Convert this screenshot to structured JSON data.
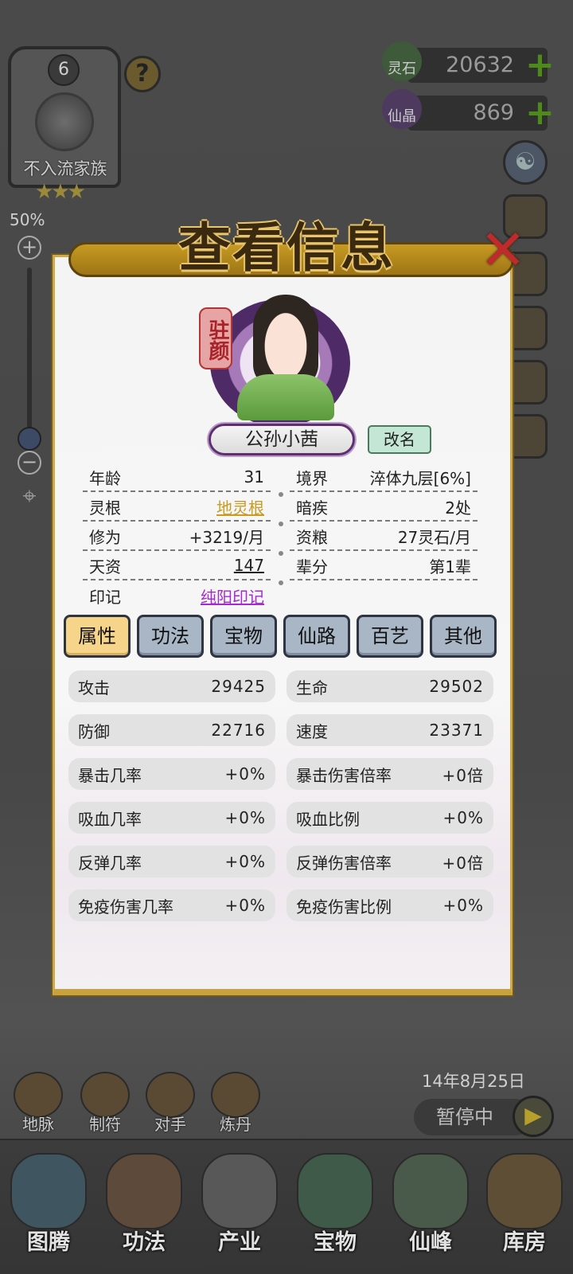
{
  "family": {
    "level": "6",
    "name": "不入流家族",
    "stars": "★★★"
  },
  "zoom": {
    "label": "50%",
    "plus": "+",
    "minus": "−",
    "level_percent": 50
  },
  "currency": {
    "spirit_stone": {
      "label": "灵石",
      "value": "20632"
    },
    "immortal_crystal": {
      "label": "仙晶",
      "value": "869"
    },
    "plus": "+"
  },
  "dialog": {
    "title": "查看信息",
    "close": "✕",
    "seal": "驻颜",
    "character_name": "公孙小茜",
    "rename_label": "改名",
    "info_left": [
      {
        "label": "年龄",
        "value": "31"
      },
      {
        "label": "灵根",
        "value": "地灵根"
      },
      {
        "label": "修为",
        "value": "+3219/月"
      },
      {
        "label": "天资",
        "value": "147"
      },
      {
        "label": "印记",
        "value": "纯阳印记"
      }
    ],
    "info_right": [
      {
        "label": "境界",
        "value": "淬体九层[6%]"
      },
      {
        "label": "暗疾",
        "value": "2处"
      },
      {
        "label": "资粮",
        "value": "27灵石/月"
      },
      {
        "label": "辈分",
        "value": "第1辈"
      }
    ],
    "tabs": [
      {
        "label": "属性",
        "active": true
      },
      {
        "label": "功法",
        "active": false
      },
      {
        "label": "宝物",
        "active": false
      },
      {
        "label": "仙路",
        "active": false
      },
      {
        "label": "百艺",
        "active": false
      },
      {
        "label": "其他",
        "active": false
      }
    ],
    "stats": [
      {
        "label": "攻击",
        "value": "29425"
      },
      {
        "label": "生命",
        "value": "29502"
      },
      {
        "label": "防御",
        "value": "22716"
      },
      {
        "label": "速度",
        "value": "23371"
      },
      {
        "label": "暴击几率",
        "value": "+0%"
      },
      {
        "label": "暴击伤害倍率",
        "value": "+0倍"
      },
      {
        "label": "吸血几率",
        "value": "+0%"
      },
      {
        "label": "吸血比例",
        "value": "+0%"
      },
      {
        "label": "反弹几率",
        "value": "+0%"
      },
      {
        "label": "反弹伤害倍率",
        "value": "+0倍"
      },
      {
        "label": "免疫伤害几率",
        "value": "+0%"
      },
      {
        "label": "免疫伤害比例",
        "value": "+0%"
      }
    ]
  },
  "game": {
    "date": "14年8月25日",
    "pause_label": "暂停中",
    "play_icon": "▶"
  },
  "quick_actions": [
    {
      "label": "地脉",
      "icon": "dragon-vein-icon"
    },
    {
      "label": "制符",
      "icon": "talisman-icon"
    },
    {
      "label": "对手",
      "icon": "rival-gate-icon"
    },
    {
      "label": "炼丹",
      "icon": "alchemy-furnace-icon"
    }
  ],
  "bottom_nav": [
    {
      "label": "图腾",
      "icon": "totem-icon"
    },
    {
      "label": "功法",
      "icon": "technique-icon"
    },
    {
      "label": "产业",
      "icon": "industry-icon"
    },
    {
      "label": "宝物",
      "icon": "treasure-icon"
    },
    {
      "label": "仙峰",
      "icon": "immortal-peak-icon"
    },
    {
      "label": "库房",
      "icon": "storehouse-icon"
    }
  ],
  "colors": {
    "active_tab": "#f6d58a",
    "inactive_tab": "#a9b6c6",
    "spirit_root_link": "#c89b22",
    "mark_link": "#a42ad0",
    "plus_green": "#4e8a1a",
    "close_red": "#c02a2a"
  }
}
